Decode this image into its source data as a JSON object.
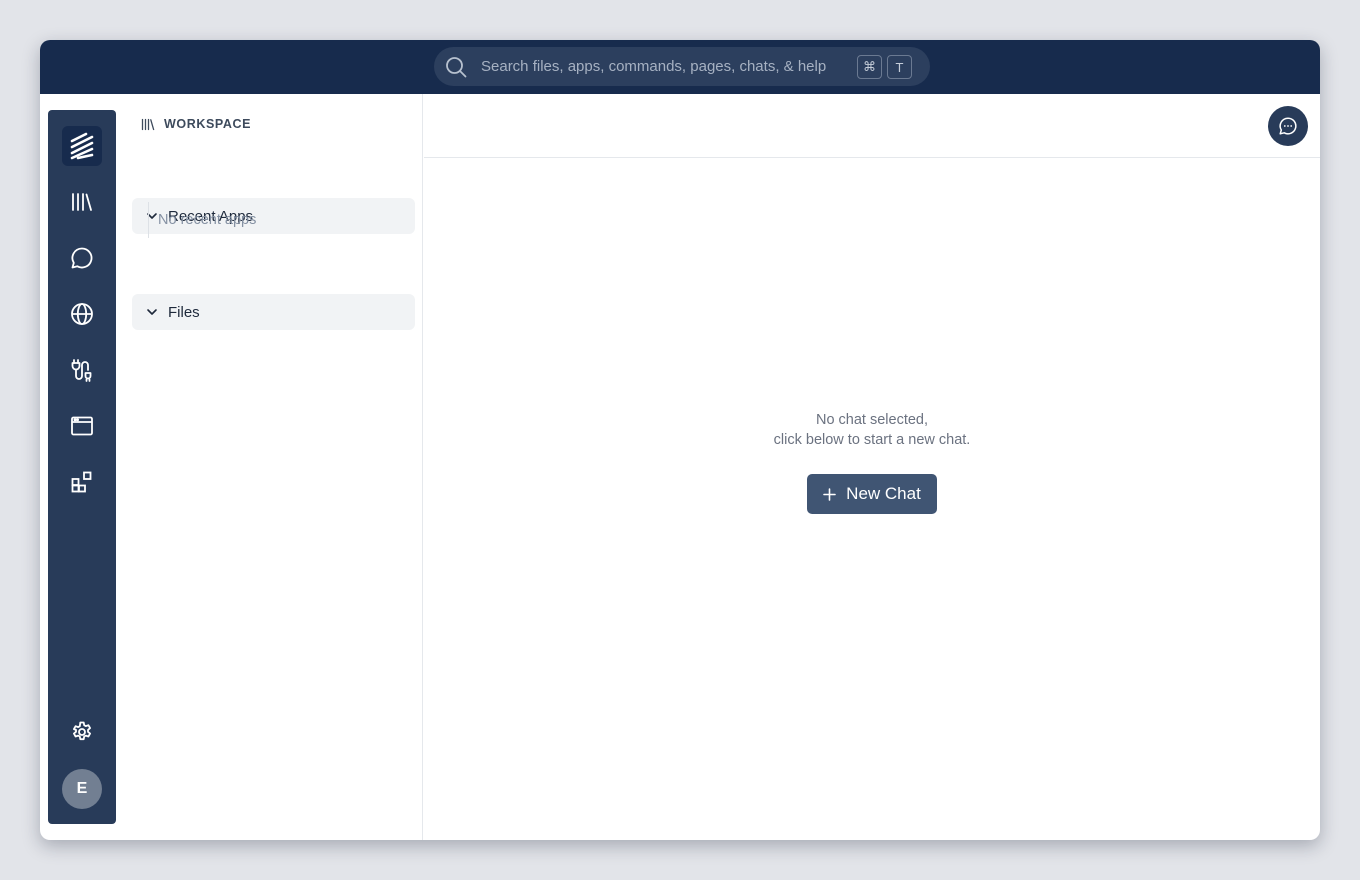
{
  "search": {
    "placeholder": "Search files, apps, commands, pages, chats, & help",
    "shortcut_mod": "⌘",
    "shortcut_key": "T"
  },
  "rail": {
    "items": [
      {
        "icon": "stacked-logo-icon"
      },
      {
        "icon": "library-icon"
      },
      {
        "icon": "chat-bubble-icon"
      },
      {
        "icon": "globe-icon"
      },
      {
        "icon": "integration-icon"
      },
      {
        "icon": "browser-window-icon"
      },
      {
        "icon": "apps-grid-icon"
      },
      {
        "icon": "gear-icon"
      }
    ],
    "avatar_initial": "E"
  },
  "workspace": {
    "title": "WORKSPACE",
    "sections": [
      {
        "label": "Recent Apps",
        "empty_text": "No recent apps"
      },
      {
        "label": "Files"
      }
    ]
  },
  "main": {
    "empty_line1": "No chat selected,",
    "empty_line2": "click below to start a new chat.",
    "new_chat_label": "New Chat"
  },
  "colors": {
    "topbar": "#172b4d",
    "rail": "#283b59",
    "button": "#405573"
  }
}
